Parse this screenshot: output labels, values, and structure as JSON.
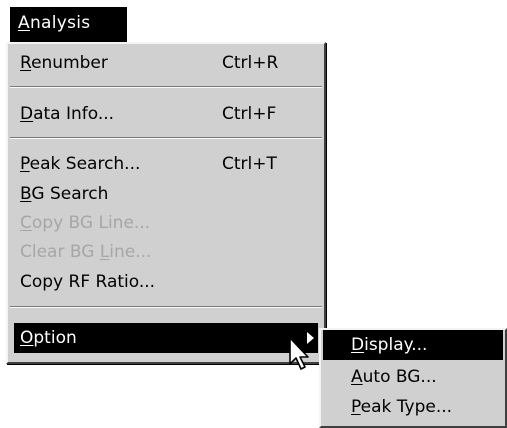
{
  "menubar": {
    "title_u": "A",
    "title_rest": "nalysis"
  },
  "menu": {
    "renumber": {
      "u": "R",
      "rest": "enumber",
      "shortcut": "Ctrl+R"
    },
    "data_info": {
      "u": "D",
      "rest": "ata Info...",
      "shortcut": "Ctrl+F"
    },
    "peak_search": {
      "u": "P",
      "rest": "eak Search...",
      "shortcut": "Ctrl+T"
    },
    "bg_search": {
      "u": "B",
      "rest": "G Search"
    },
    "copy_bg_line": {
      "u": "C",
      "rest": "opy BG Line..."
    },
    "clear_bg_line": {
      "pre": "Clear BG ",
      "u": "L",
      "rest": "ine..."
    },
    "copy_rf_ratio": {
      "label": "Copy RF Ratio..."
    },
    "option": {
      "u": "O",
      "rest": "ption"
    }
  },
  "submenu": {
    "display": {
      "u": "D",
      "rest": "isplay..."
    },
    "auto_bg": {
      "u": "A",
      "rest": "uto BG..."
    },
    "peak_type": {
      "u": "P",
      "rest": "eak Type..."
    }
  },
  "colors": {
    "menu_bg": "#d0d0d0",
    "highlight": "#000000",
    "disabled_text": "#a6a6a6"
  },
  "icons": {
    "cursor": "arrow-pointer",
    "submenu": "submenu-arrow"
  }
}
